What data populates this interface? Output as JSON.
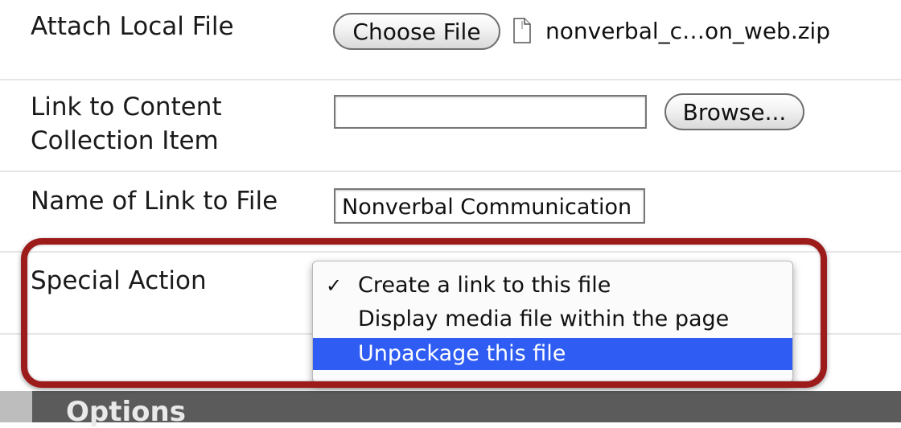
{
  "attach": {
    "label": "Attach Local File",
    "button_label": "Choose File",
    "file_name": "nonverbal_c…on_web.zip"
  },
  "link_content": {
    "label_line1": "Link to Content",
    "label_line2": "Collection Item",
    "input_value": "",
    "button_label": "Browse..."
  },
  "link_name": {
    "label": "Name of Link to File",
    "input_value": "Nonverbal Communication"
  },
  "special_action": {
    "label": "Special Action",
    "options": [
      {
        "label": "Create a link to this file",
        "checked": true
      },
      {
        "label": "Display media file within the page",
        "checked": false
      },
      {
        "label": "Unpackage this file",
        "checked": false
      }
    ],
    "checkmark": "✓",
    "highlighted_index": 2,
    "highlight_color": "#2f5cf3",
    "frame_color": "#9c1b1b"
  },
  "options_section": {
    "label": "Options"
  }
}
